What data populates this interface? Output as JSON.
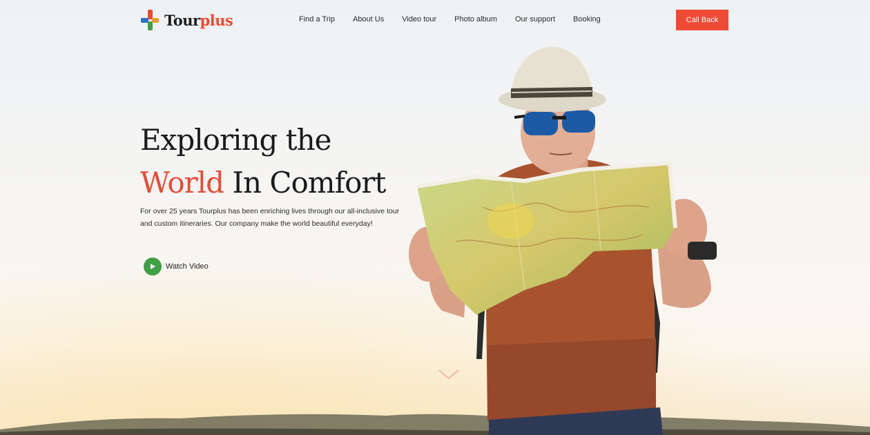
{
  "brand": {
    "name_part1": "Tour",
    "name_part2": "plus",
    "colors": {
      "red": "#e84b34",
      "green": "#3fa045",
      "orange": "#f39c2b",
      "blue": "#2b72c9"
    }
  },
  "nav": {
    "items": [
      "Find a Trip",
      "About Us",
      "Video tour",
      "Photo album",
      "Our support",
      "Booking"
    ]
  },
  "cta": {
    "label": "Call Back",
    "color": "#ef4a36"
  },
  "hero": {
    "title_line1": "Exploring the",
    "title_accent": "World",
    "title_rest": " In Comfort",
    "description": "For over 25 years Tourplus has been enriching lives through our all-inclusive tour and custom itineraries. Our company make the world beautiful everyday!",
    "watch_label": "Watch Video"
  },
  "icons": {
    "play": "play-icon",
    "scroll": "chevron-down-icon"
  }
}
